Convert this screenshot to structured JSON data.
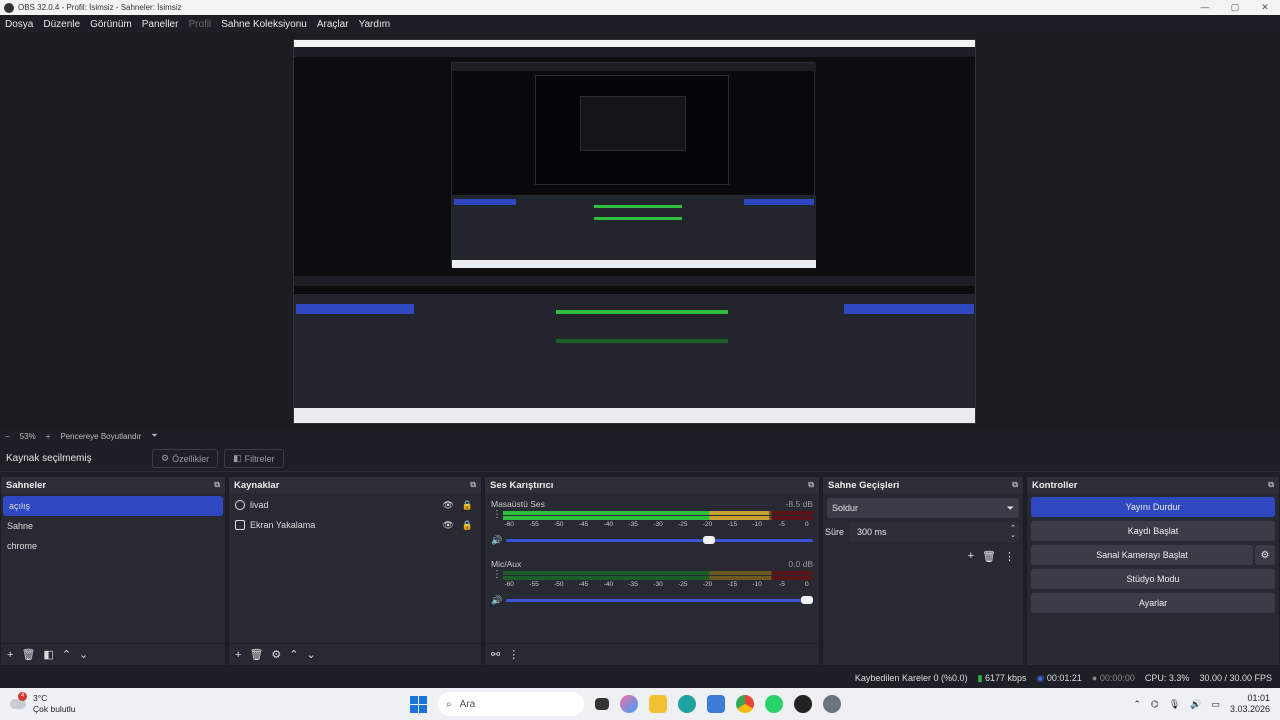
{
  "window": {
    "title": "OBS 32.0.4 - Profil: İsimsiz - Sahneler: İsimsiz"
  },
  "menu": [
    {
      "label": "Dosya",
      "enabled": true
    },
    {
      "label": "Düzenle",
      "enabled": true
    },
    {
      "label": "Görünüm",
      "enabled": true
    },
    {
      "label": "Paneller",
      "enabled": true
    },
    {
      "label": "Profil",
      "enabled": false
    },
    {
      "label": "Sahne Koleksiyonu",
      "enabled": true
    },
    {
      "label": "Araçlar",
      "enabled": true
    },
    {
      "label": "Yardım",
      "enabled": true
    }
  ],
  "zoom": {
    "minus": "−",
    "value": "53%",
    "plus": "+",
    "fit_label": "Pencereye Boyutlandır"
  },
  "props": {
    "no_source": "Kaynak seçilmemiş",
    "properties": "Özellikler",
    "filters": "Filtreler"
  },
  "scenes": {
    "title": "Sahneler",
    "items": [
      "açılış",
      "Sahne",
      "chrome"
    ],
    "selected_index": 0
  },
  "sources": {
    "title": "Kaynaklar",
    "items": [
      {
        "name": "livad",
        "type": "browser"
      },
      {
        "name": "Ekran Yakalama",
        "type": "display"
      }
    ]
  },
  "mixer": {
    "title": "Ses Karıştırıcı",
    "ticks": [
      "-60",
      "-55",
      "-50",
      "-45",
      "-40",
      "-35",
      "-30",
      "-25",
      "-20",
      "-15",
      "-10",
      "-5",
      "0"
    ],
    "channels": [
      {
        "name": "Masaüstü Ses",
        "db": "-8.5 dB",
        "volume": 0.68,
        "level_db": -8.5,
        "peak_db": -20
      },
      {
        "name": "Mic/Aux",
        "db": "0.0 dB",
        "volume": 1.0,
        "level_db": -60,
        "peak_db": -60
      }
    ]
  },
  "transitions": {
    "title": "Sahne Geçişleri",
    "selected": "Soldur",
    "duration_label": "Süre",
    "duration": "300 ms"
  },
  "controls": {
    "title": "Kontroller",
    "buttons": [
      "Yayını Durdur",
      "Kaydı Başlat",
      "Sanal Kamerayı Başlat",
      "Stüdyo Modu",
      "Ayarlar"
    ]
  },
  "status": {
    "dropped": "Kaybedilen Kareler 0 (%0.0)",
    "bitrate": "6177 kbps",
    "stream_time": "00:01:21",
    "rec_time": "00:00:00",
    "cpu": "CPU: 3.3%",
    "fps": "30.00 / 30.00 FPS"
  },
  "taskbar": {
    "weather_temp": "3°C",
    "weather_desc": "Çok bulutlu",
    "weather_badge": "4",
    "search_placeholder": "Ara",
    "time": "01:01",
    "date": "3.03.2026"
  },
  "colors": {
    "accent": "#2f48c1",
    "meter_green": "#2fbf3f",
    "meter_yellow": "#c7a431",
    "meter_red": "#8c1e24"
  }
}
